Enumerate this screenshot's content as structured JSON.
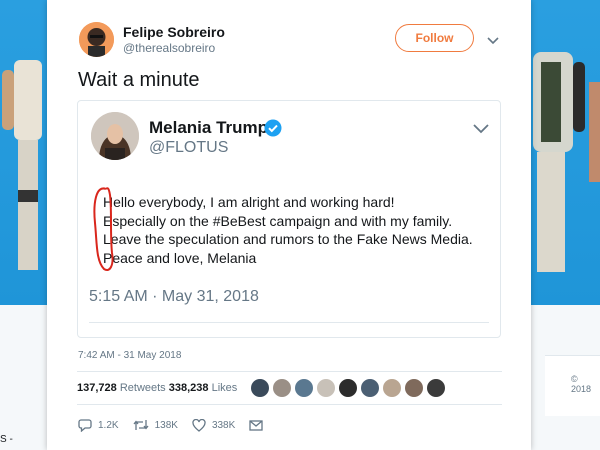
{
  "outer_tweet": {
    "author_name": "Felipe Sobreiro",
    "author_handle": "@therealsobreiro",
    "follow_label": "Follow",
    "text": "Wait a minute",
    "timestamp": "7:42 AM - 31 May 2018",
    "retweets_count": "137,728",
    "retweets_label": "Retweets",
    "likes_count": "338,238",
    "likes_label": "Likes",
    "actions": {
      "reply_count": "1.2K",
      "retweet_count": "138K",
      "like_count": "338K"
    }
  },
  "embedded_tweet": {
    "author_name": "Melania Trump",
    "author_handle": "@FLOTUS",
    "lines": [
      "Hello everybody, I am alright and working hard!",
      "Especially on the #BeBest campaign and with my family.",
      "Leave the speculation and rumors to the Fake News Media.",
      "Peace and love, Melania"
    ],
    "timestamp": "5:15 AM · May 31, 2018"
  },
  "background": {
    "left_text": "S -",
    "right_text": "© 2018"
  },
  "colors": {
    "accent": "#f07b3f",
    "verified": "#1da1f2",
    "annotation": "#d9261c",
    "banner": "#2a9fe0"
  }
}
